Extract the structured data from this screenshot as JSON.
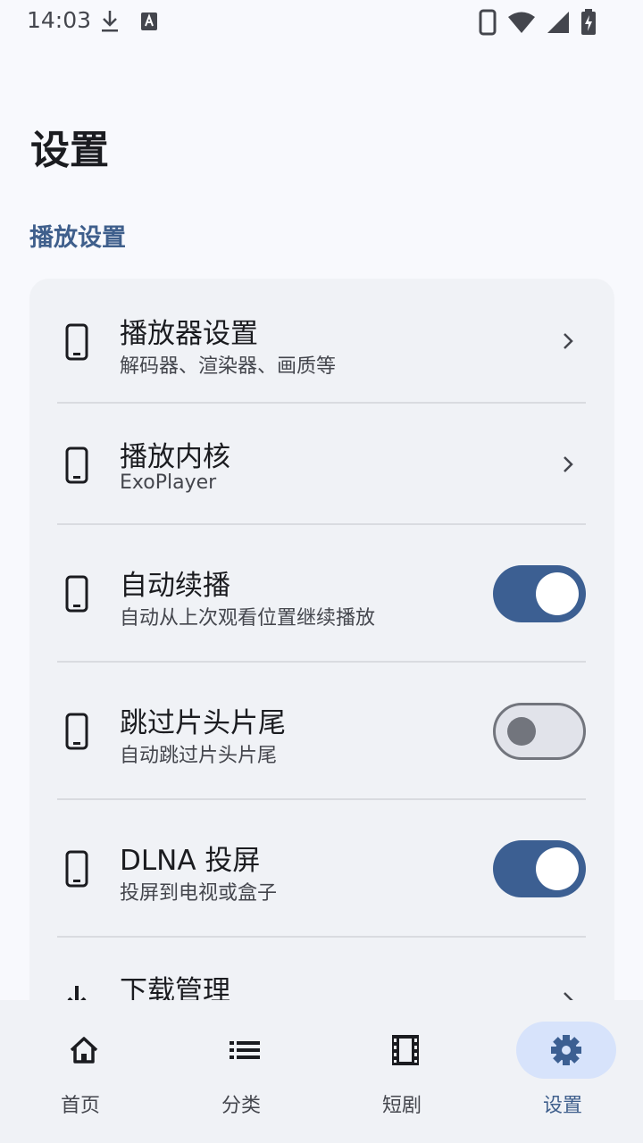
{
  "status_bar": {
    "time": "14:03",
    "left_icons": [
      "download-icon",
      "keyboard-a-icon"
    ],
    "right_icons": [
      "phone-icon",
      "wifi-icon",
      "cellular-icon",
      "battery-charging-icon"
    ]
  },
  "page_title": "设置",
  "section": {
    "title": "播放设置"
  },
  "items": [
    {
      "title": "播放器设置",
      "subtitle": "解码器、渲染器、画质等",
      "icon": "phone-icon",
      "control": "chevron"
    },
    {
      "title": "播放内核",
      "subtitle": "ExoPlayer",
      "icon": "phone-icon",
      "control": "chevron"
    },
    {
      "title": "自动续播",
      "subtitle": "自动从上次观看位置继续播放",
      "icon": "phone-icon",
      "control": "switch",
      "checked": true
    },
    {
      "title": "跳过片头片尾",
      "subtitle": "自动跳过片头片尾",
      "icon": "phone-icon",
      "control": "switch",
      "checked": false
    },
    {
      "title": "DLNA 投屏",
      "subtitle": "投屏到电视或盒子",
      "icon": "phone-icon",
      "control": "switch",
      "checked": true
    },
    {
      "title": "下载管理",
      "subtitle": "",
      "icon": "download-icon",
      "control": "chevron"
    }
  ],
  "bottom_nav": [
    {
      "label": "首页",
      "icon": "home-icon",
      "active": false
    },
    {
      "label": "分类",
      "icon": "list-icon",
      "active": false
    },
    {
      "label": "短剧",
      "icon": "film-icon",
      "active": false
    },
    {
      "label": "设置",
      "icon": "gear-icon",
      "active": true
    }
  ],
  "colors": {
    "background": "#f8f9fd",
    "card": "#f0f2f6",
    "accent": "#3c5f92",
    "section_title": "#3f5f8c",
    "nav_active_pill": "#d7e3fb"
  }
}
